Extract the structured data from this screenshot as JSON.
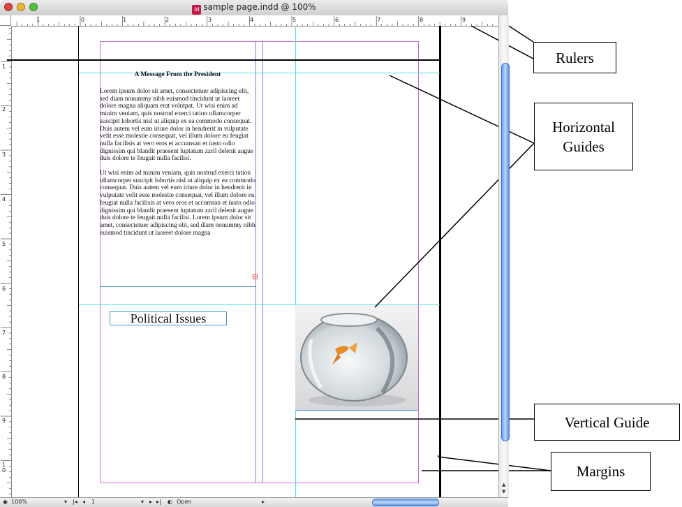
{
  "window": {
    "title": "sample page.indd @ 100%",
    "doc_icon": "Id"
  },
  "ruler": {
    "top_labels": [
      "1",
      "0",
      "1",
      "2",
      "3",
      "4",
      "5",
      "6",
      "7",
      "8",
      "9"
    ],
    "left_labels": [
      "1",
      "2",
      "3",
      "4",
      "5",
      "6",
      "7",
      "8",
      "9",
      "10"
    ]
  },
  "article": {
    "headline": "A Message From the President",
    "paragraphs": [
      "Lorem ipsum dolor sit amet, consectetuer adipiscing elit, sed diam nonummy nibh euismod tincidunt ut laoreet dolore magna aliquam erat volutpat. Ut wisi enim ad minim veniam, quis nostrud exerci tation ullamcorper suscipit lobortis nisl ut aliquip ex ea commodo consequat. Duis autem vel eum iriure dolor in hendrerit in vulputate velit esse molestie consequat, vel illum dolore eu feugiat nulla facilisis at vero eros et accumsan et iusto odio dignissim qui blandit praesent luptatum zzril delenit augue duis dolore te feugait nulla facilisi.",
      "Ut wisi enim ad minim veniam, quis nostrud exerci tation ullamcorper suscipit lobortis nisl ut aliquip ex ea commodo consequat. Duis autem vel eum iriure dolor in hendrerit in vulputate velit esse molestie consequat, vel illum dolore eu feugiat nulla facilisis at vero eros et accumsan et iusto odio dignissim qui blandit praesent luptatum zzril delenit augue duis dolore te feugait nulla facilisi. Lorem ipsum dolor sit amet, consectetuer adipiscing elit, sed diam nonummy nibh euismod tincidunt ut laoreet dolore magna"
    ],
    "subhead": "Political Issues"
  },
  "status": {
    "zoom": "100%",
    "page": "1",
    "open_label": "Open"
  },
  "callouts": {
    "rulers": "Rulers",
    "horizontal_guides": "Horizontal Guides",
    "vertical_guide": "Vertical Guide",
    "margins": "Margins"
  },
  "colors": {
    "margin_guide": "#c86bd6",
    "ruler_guide": "#4fe0e0",
    "scroll_accent": "#5a8fe0"
  },
  "icons": {
    "close": "close-icon",
    "minimize": "minimize-icon",
    "zoom": "zoom-icon"
  }
}
